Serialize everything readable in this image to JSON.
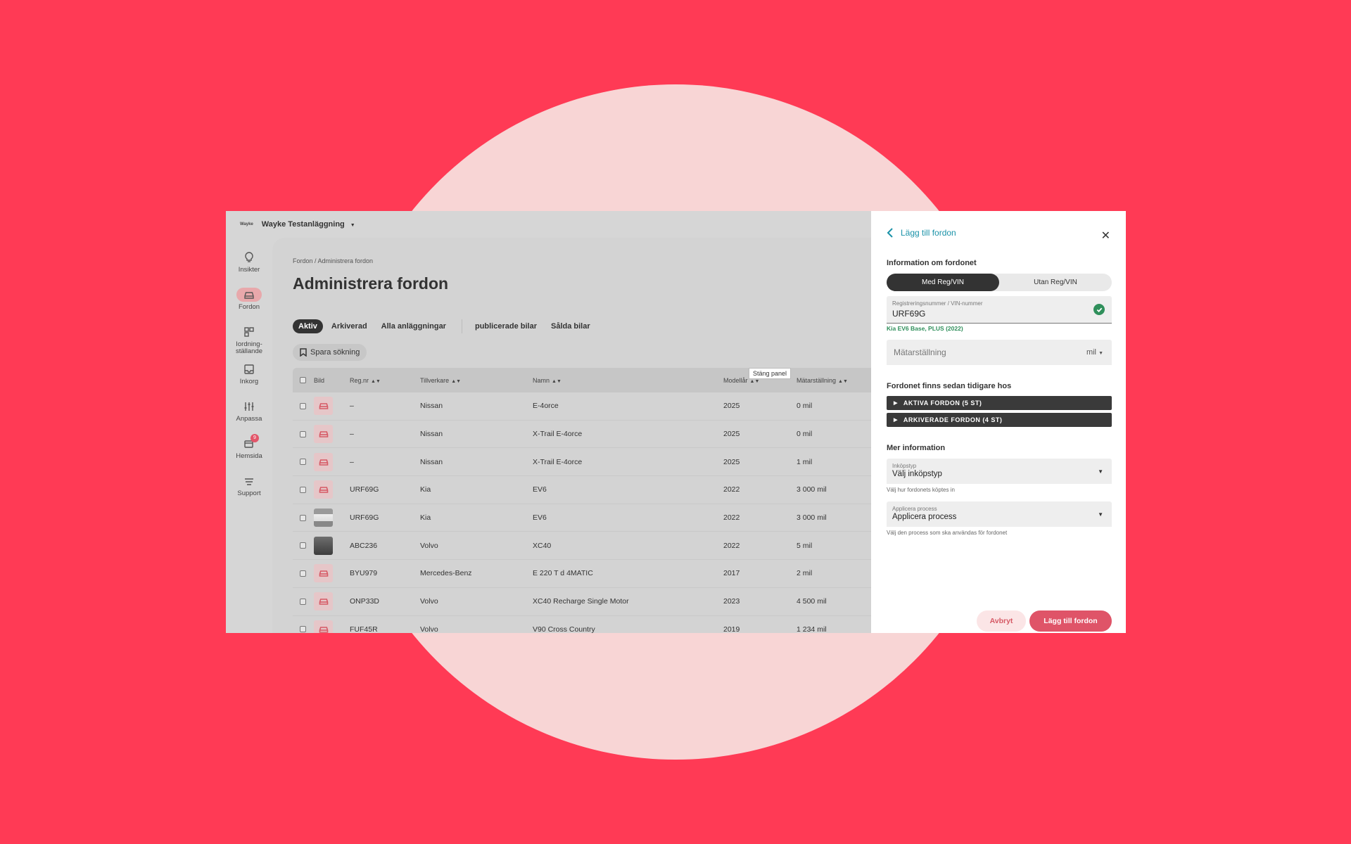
{
  "app": {
    "logo": "Wayke",
    "org_name": "Wayke Testanläggning"
  },
  "sidebar": {
    "items": [
      {
        "label": "Insikter"
      },
      {
        "label": "Fordon"
      },
      {
        "label": "Iordning-\nställande"
      },
      {
        "label": "Inkorg"
      },
      {
        "label": "Anpassa"
      },
      {
        "label": "Hemsida",
        "badge": "9"
      },
      {
        "label": "Support"
      }
    ]
  },
  "page": {
    "breadcrumb": "Fordon / Administrera fordon",
    "title": "Administrera fordon",
    "tabs": [
      "Aktiv",
      "Arkiverad",
      "Alla anläggningar",
      "publicerade bilar",
      "Sålda bilar"
    ],
    "save_search": "Spara sökning",
    "tooltip": "Stäng panel"
  },
  "table": {
    "headers": {
      "image": "Bild",
      "reg": "Reg.nr",
      "manufacturer": "Tillverkare",
      "name": "Namn",
      "year": "Modellår",
      "odometer": "Mätarställning"
    },
    "rows": [
      {
        "reg": "–",
        "manufacturer": "Nissan",
        "name": "E-4orce",
        "year": "2025",
        "odometer": "0 mil"
      },
      {
        "reg": "–",
        "manufacturer": "Nissan",
        "name": "X-Trail E-4orce",
        "year": "2025",
        "odometer": "0 mil"
      },
      {
        "reg": "–",
        "manufacturer": "Nissan",
        "name": "X-Trail E-4orce",
        "year": "2025",
        "odometer": "1 mil"
      },
      {
        "reg": "URF69G",
        "manufacturer": "Kia",
        "name": "EV6",
        "year": "2022",
        "odometer": "3 000 mil"
      },
      {
        "reg": "URF69G",
        "manufacturer": "Kia",
        "name": "EV6",
        "year": "2022",
        "odometer": "3 000 mil"
      },
      {
        "reg": "ABC236",
        "manufacturer": "Volvo",
        "name": "XC40",
        "year": "2022",
        "odometer": "5 mil"
      },
      {
        "reg": "BYU979",
        "manufacturer": "Mercedes-Benz",
        "name": "E 220 T d 4MATIC",
        "year": "2017",
        "odometer": "2 mil"
      },
      {
        "reg": "ONP33D",
        "manufacturer": "Volvo",
        "name": "XC40 Recharge Single Motor",
        "year": "2023",
        "odometer": "4 500 mil"
      },
      {
        "reg": "FUF45R",
        "manufacturer": "Volvo",
        "name": "V90 Cross Country",
        "year": "2019",
        "odometer": "1 234 mil"
      }
    ]
  },
  "panel": {
    "title": "Lägg till fordon",
    "section_info": "Information om fordonet",
    "toggle": {
      "with": "Med Reg/VIN",
      "without": "Utan Reg/VIN"
    },
    "reg_field": {
      "label": "Registreringsnummer / VIN-nummer",
      "value": "URF69G"
    },
    "match_hint": "Kia EV6 Base, PLUS (2022)",
    "odometer": {
      "placeholder": "Mätarställning",
      "unit": "mil"
    },
    "section_existing": "Fordonet finns sedan tidigare hos",
    "active_vehicles": "AKTIVA FORDON (5 ST)",
    "archived_vehicles": "ARKIVERADE FORDON (4 ST)",
    "section_more": "Mer information",
    "purchase_type": {
      "label": "Inköpstyp",
      "value": "Välj inköpstyp",
      "help": "Välj hur fordonets köptes in"
    },
    "process": {
      "label": "Applicera process",
      "value": "Applicera process",
      "help": "Välj den process som ska användas för fordonet"
    },
    "cancel": "Avbryt",
    "submit": "Lägg till fordon"
  }
}
